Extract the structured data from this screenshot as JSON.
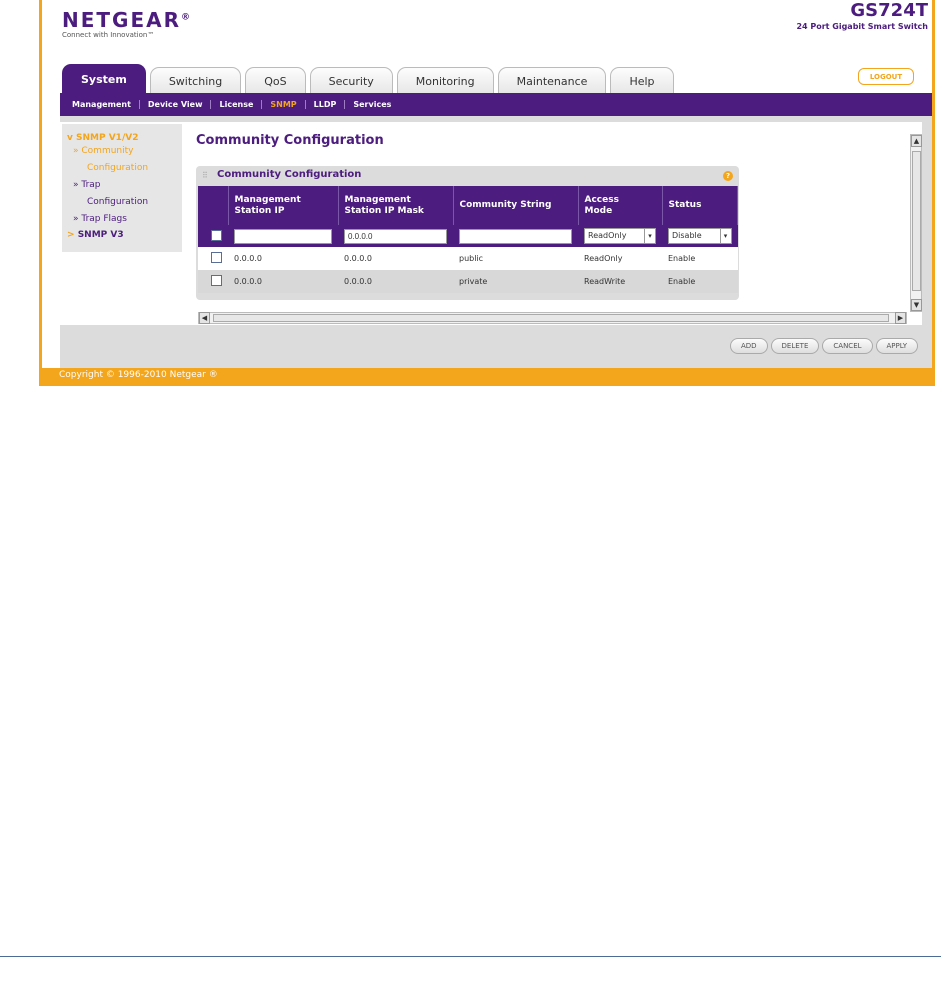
{
  "brand": {
    "logo": "NETGEAR",
    "logo_mark": "®",
    "tagline": "Connect with Innovation™",
    "model": "GS724T",
    "model_sub": "24 Port Gigabit Smart Switch"
  },
  "tabs": [
    "System",
    "Switching",
    "QoS",
    "Security",
    "Monitoring",
    "Maintenance",
    "Help"
  ],
  "active_tab": "System",
  "logout_label": "LOGOUT",
  "subnav": [
    "Management",
    "Device View",
    "License",
    "SNMP",
    "LLDP",
    "Services"
  ],
  "active_subnav": "SNMP",
  "sidebar": {
    "group1": "SNMP V1/V2",
    "group1_marker": "v",
    "item1": {
      "marker": "»",
      "line1": "Community",
      "line2": "Configuration"
    },
    "item2": {
      "marker": "»",
      "line1": "Trap",
      "line2": "Configuration"
    },
    "item3": {
      "marker": "»",
      "line1": "Trap Flags"
    },
    "group2": "SNMP V3",
    "group2_marker": ">"
  },
  "page_title": "Community Configuration",
  "panel": {
    "title": "Community Configuration",
    "help_icon": "?"
  },
  "table": {
    "headers": [
      "Management Station IP",
      "Management Station IP Mask",
      "Community String",
      "Access Mode",
      "Status"
    ],
    "headers_split": [
      [
        "Management",
        "Station IP"
      ],
      [
        "Management",
        "Station IP Mask"
      ],
      [
        "Community String",
        ""
      ],
      [
        "Access",
        "Mode"
      ],
      [
        "Status",
        ""
      ]
    ],
    "edit_row": {
      "ip": "",
      "mask": "0.0.0.0",
      "community": "",
      "access": "ReadOnly",
      "status": "Disable"
    },
    "rows": [
      {
        "ip": "0.0.0.0",
        "mask": "0.0.0.0",
        "community": "public",
        "access": "ReadOnly",
        "status": "Enable"
      },
      {
        "ip": "0.0.0.0",
        "mask": "0.0.0.0",
        "community": "private",
        "access": "ReadWrite",
        "status": "Enable"
      }
    ]
  },
  "buttons": {
    "add": "ADD",
    "delete": "DELETE",
    "cancel": "CANCEL",
    "apply": "APPLY"
  },
  "copyright": "Copyright © 1996-2010 Netgear ®",
  "colors": {
    "purple": "#4c1c7e",
    "orange": "#f3a51c",
    "grey": "#dcdcdc"
  }
}
